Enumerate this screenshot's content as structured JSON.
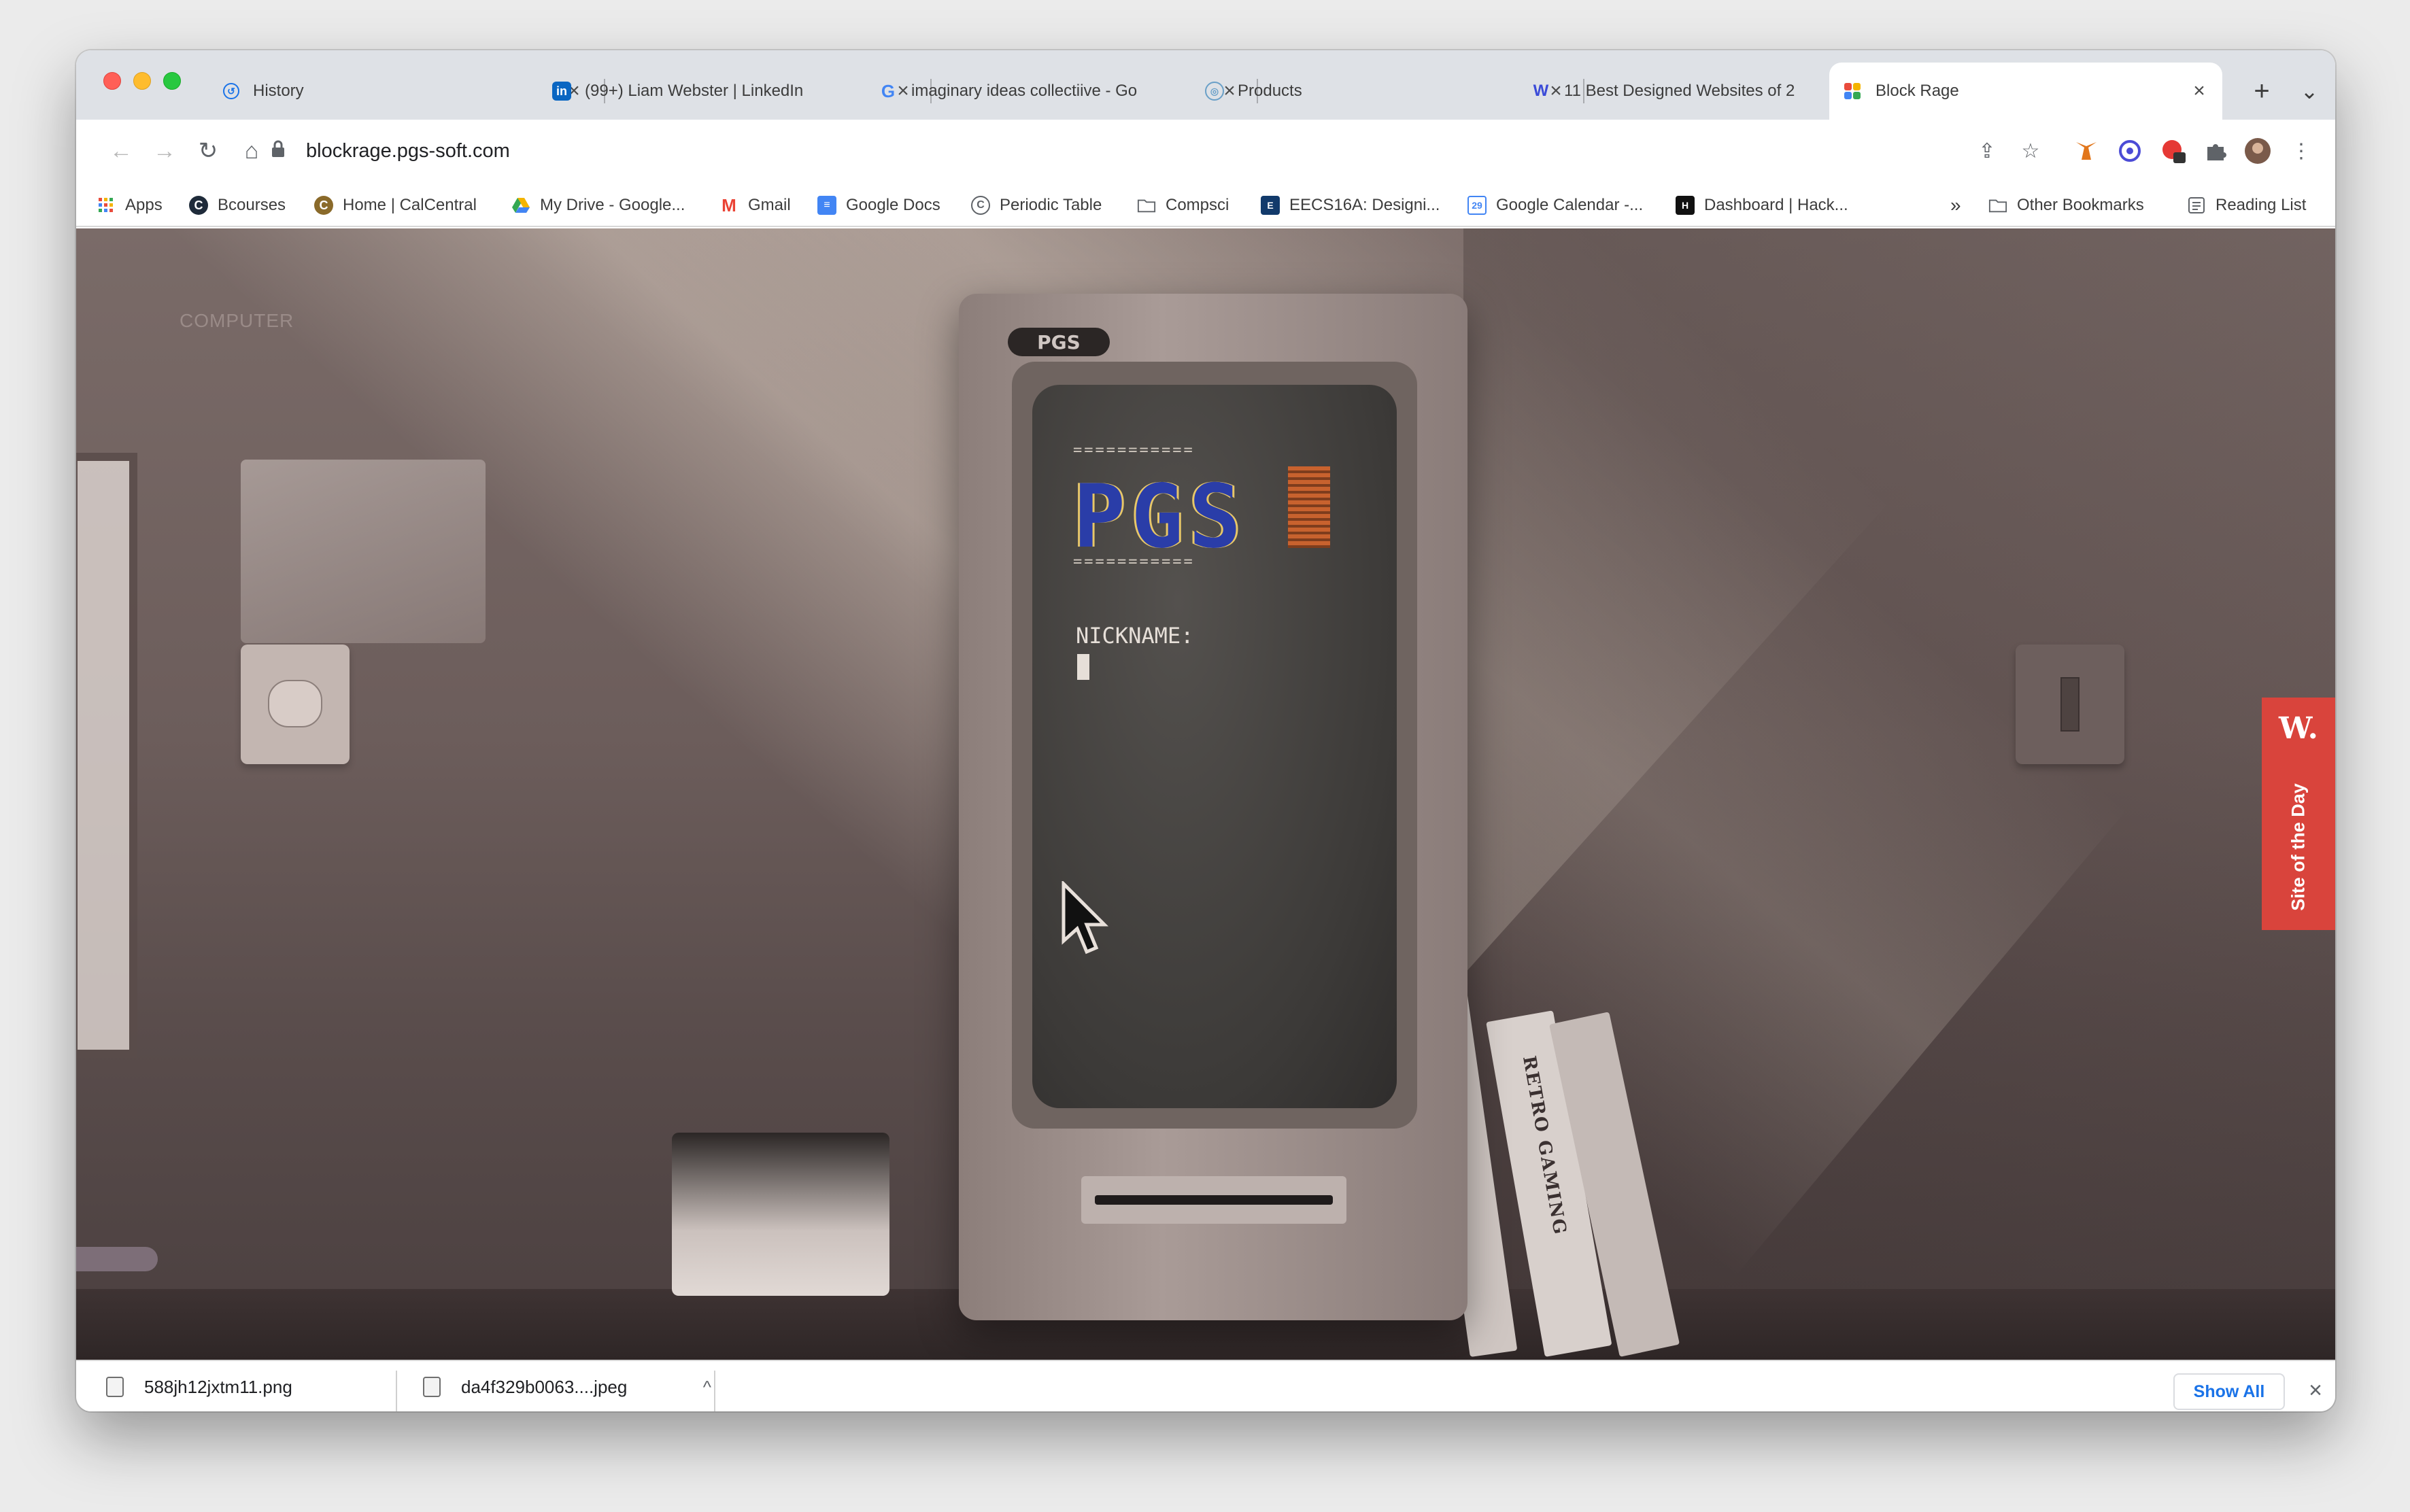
{
  "tabs": [
    {
      "title": "History",
      "icon": "history-icon",
      "close": "×"
    },
    {
      "title": "(99+) Liam Webster | LinkedIn",
      "icon": "linkedin-icon",
      "close": "×"
    },
    {
      "title": "imaginary ideas collectiive - Go",
      "icon": "google-icon",
      "close": "×"
    },
    {
      "title": "Products",
      "icon": "products-icon",
      "close": "×"
    },
    {
      "title": "11 Best Designed Websites of 2",
      "icon": "w-icon",
      "close": "×"
    },
    {
      "title": "Block Rage",
      "icon": "block-rage-icon",
      "close": "×"
    }
  ],
  "new_tab": "+",
  "tab_menu": "⌄",
  "toolbar": {
    "back": "←",
    "forward": "→",
    "reload": "↻",
    "home": "⌂",
    "url": "blockrage.pgs-soft.com",
    "share": "⇪",
    "star": "☆",
    "menu": "⋮"
  },
  "bookmarks": [
    {
      "label": "Apps",
      "icon": "apps-grid-icon"
    },
    {
      "label": "Bcourses",
      "icon": "bcourses-icon"
    },
    {
      "label": "Home | CalCentral",
      "icon": "calcentral-icon"
    },
    {
      "label": "My Drive - Google...",
      "icon": "google-drive-icon"
    },
    {
      "label": "Gmail",
      "icon": "gmail-icon"
    },
    {
      "label": "Google Docs",
      "icon": "google-docs-icon"
    },
    {
      "label": "Periodic Table",
      "icon": "periodic-table-icon"
    },
    {
      "label": "Compsci",
      "icon": "folder-icon"
    },
    {
      "label": "EECS16A: Designi...",
      "icon": "eecs-icon"
    },
    {
      "label": "Google Calendar -...",
      "icon": "google-calendar-icon"
    },
    {
      "label": "Dashboard | Hack...",
      "icon": "hack-icon"
    }
  ],
  "bookmarks_overflow": "»",
  "other_bookmarks": "Other Bookmarks",
  "reading_list": "Reading List",
  "page": {
    "computer_label": "COMPUTER",
    "pc_badge": "PGS",
    "eq_row": "===========",
    "logo_letters": "PGS",
    "nickname_label": "NICKNAME:",
    "book_title": "RETRO GAMING",
    "sotd_w": "W.",
    "sotd_text": "Site of the Day"
  },
  "downloads": [
    {
      "name": "588jh12jxtm11.png",
      "chevron": "^"
    },
    {
      "name": "da4f329b0063....jpeg",
      "chevron": "^"
    }
  ],
  "show_all": "Show All",
  "downloads_close": "×",
  "colors": {
    "tabstrip": "#dee1e6",
    "sotd_red": "#d9443c",
    "link_blue": "#1a73e8",
    "logo_blue": "#2a3da8",
    "logo_orange": "#c8622e"
  }
}
